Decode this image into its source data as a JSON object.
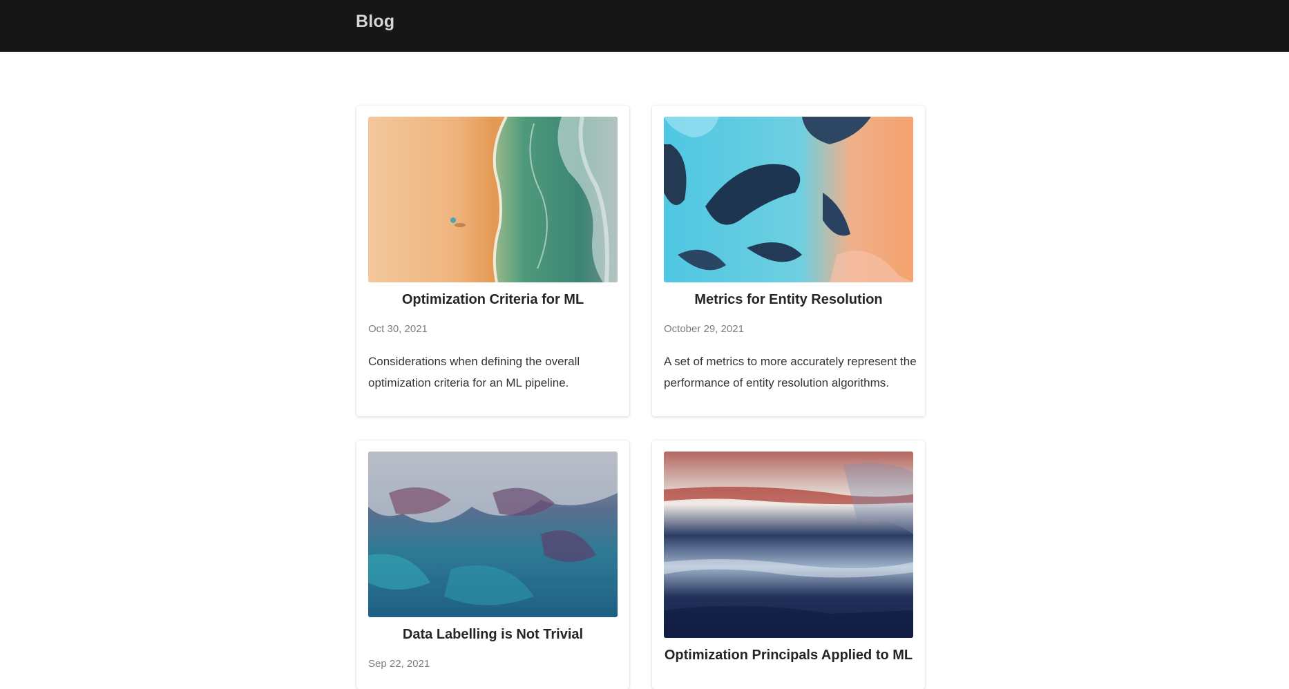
{
  "navbar": {
    "brand": "Blog"
  },
  "posts": [
    {
      "title": "Optimization Criteria for ML",
      "date": "Oct 30, 2021",
      "description": "Considerations when defining the overall optimization criteria for an ML pipeline.",
      "image": "aerial-beach-waves"
    },
    {
      "title": "Metrics for Entity Resolution",
      "date": "October 29, 2021",
      "description": "A set of metrics to more accurately represent the performance of entity resolution algorithms.",
      "image": "aerial-blue-river-delta"
    },
    {
      "title": "Data Labelling is Not Trivial",
      "date": "Sep 22, 2021",
      "description": "",
      "image": "aerial-rocky-coast"
    },
    {
      "title": "Optimization Principals Applied to ML",
      "date": "",
      "description": "",
      "image": "abstract-painted-sky"
    }
  ]
}
